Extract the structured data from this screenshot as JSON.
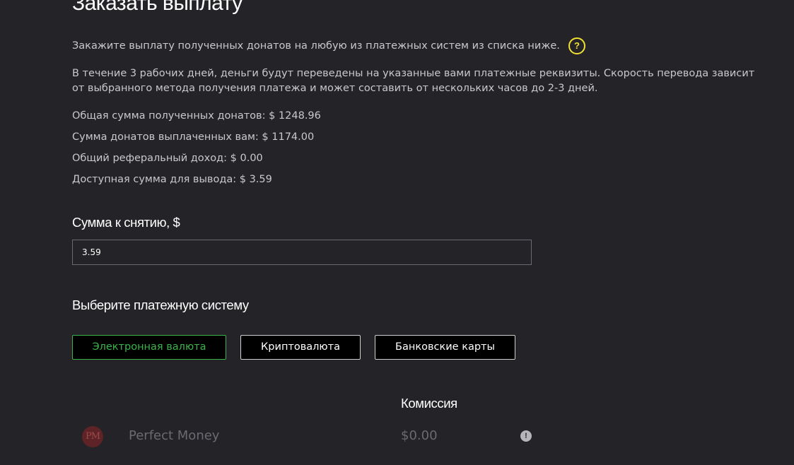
{
  "header": {
    "title": "Заказать выплату"
  },
  "intro": {
    "text": "Закажите выплату полученных донатов на любую из платежных систем из списка ниже.",
    "help_icon": "?"
  },
  "note": {
    "line1": "В течение 3 рабочих дней, деньги будут переведены на указанные вами платежные реквизиты. Скорость перевода зависит",
    "line2": "от выбранного метода получения платежа и может составить от нескольких часов до 2-3 дней."
  },
  "stats": [
    {
      "label": "Общая сумма полученных донатов:",
      "value": "$ 1248.96"
    },
    {
      "label": "Сумма донатов выплаченных вам:",
      "value": "$ 1174.00"
    },
    {
      "label": "Общий реферальный доход:",
      "value": "$ 0.00"
    },
    {
      "label": "Доступная сумма для вывода:",
      "value": "$ 3.59"
    }
  ],
  "amount": {
    "label": "Сумма к снятию, $",
    "value": "3.59"
  },
  "payment": {
    "label": "Выберите платежную систему",
    "tabs": [
      {
        "label": "Электронная валюта",
        "active": true
      },
      {
        "label": "Криптовалюта",
        "active": false
      },
      {
        "label": "Банковские карты",
        "active": false
      }
    ],
    "commission_header": "Комиссия",
    "methods": [
      {
        "logo_text": "PM",
        "name": "Perfect Money",
        "fee": "$0.00",
        "info_icon": "!"
      }
    ]
  },
  "colors": {
    "background": "#242428",
    "text": "#c9c9cc",
    "heading": "#ffffff",
    "accent_green": "#3bb54a",
    "help_yellow": "#f0e130",
    "disabled": "#6a6a70"
  }
}
